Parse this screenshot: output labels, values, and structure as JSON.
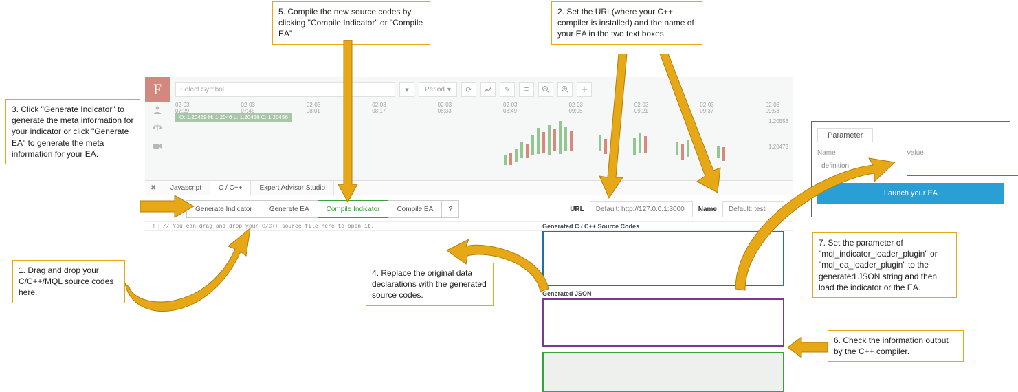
{
  "callouts": {
    "c1": "1. Drag and drop your C/C++/MQL source codes here.",
    "c2": "2. Set the URL(where your C++ compiler is installed) and the name of your EA in the two text boxes.",
    "c3": "3. Click \"Generate Indicator\" to generate the meta information for your indicator or click \"Generate EA\" to generate the meta information for your EA.",
    "c4": "4. Replace the original data declarations with the generated source codes.",
    "c5": "5. Compile the new source codes by clicking \"Compile Indicator\" or \"Compile EA\"",
    "c6": "6. Check the information output by the C++ compiler.",
    "c7": "7. Set the parameter of \"mql_indicator_loader_plugin\" or \"mql_ea_loader_plugin\" to the generated JSON string and then load the indicator or the EA."
  },
  "toolbar": {
    "symbol_placeholder": "Select Symbol",
    "period_label": "Period"
  },
  "times": [
    "02-03 07:29",
    "02-03 07:45",
    "02-03 08:01",
    "02-03 08:17",
    "02-03 08:33",
    "02-03 08:49",
    "02-03 09:05",
    "02-03 09:21",
    "02-03 09:37",
    "02-03 09:53"
  ],
  "ohlc": "O: 1.20459 H: 1.2046 L: 1.20456 C: 1.20456",
  "prices": [
    "1.20553",
    "1.20473"
  ],
  "tabs": {
    "js": "Javascript",
    "cc": "C / C++",
    "eas": "Expert Advisor Studio"
  },
  "buttons": {
    "gen_ind": "Generate Indicator",
    "gen_ea": "Generate EA",
    "comp_ind": "Compile Indicator",
    "comp_ea": "Compile EA",
    "help": "?"
  },
  "fields": {
    "url_label": "URL",
    "url_placeholder": "Default: http://127.0.0.1:3000",
    "name_label": "Name",
    "name_placeholder": "Default: test"
  },
  "editor": {
    "lineno": "1",
    "hint": "// You can drag and drop your C/C++ source file here to open it."
  },
  "out": {
    "src_label": "Generated C / C++ Source Codes",
    "json_label": "Generated JSON"
  },
  "param": {
    "tab": "Parameter",
    "col_name": "Name",
    "col_value": "Value",
    "row_name": "definition",
    "launch": "Launch your EA"
  }
}
